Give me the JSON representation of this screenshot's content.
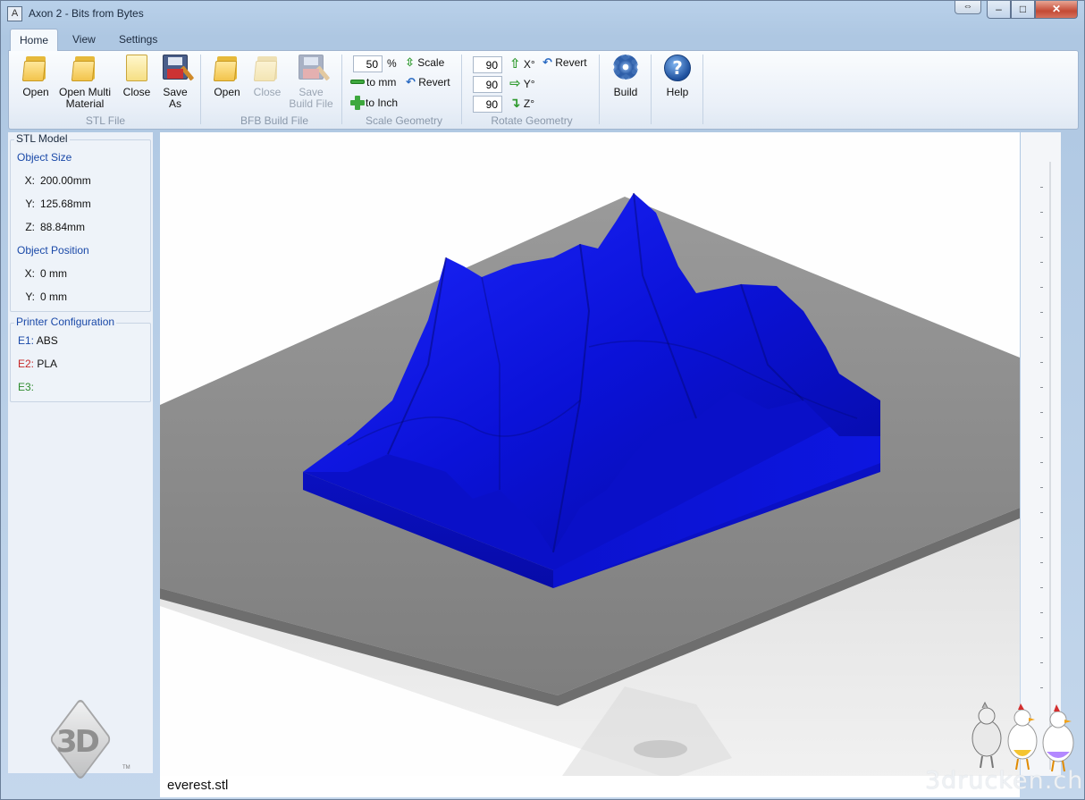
{
  "window": {
    "title": "Axon 2 - Bits from Bytes",
    "controls": {
      "minimize": "–",
      "maximize": "□",
      "close": "✕"
    }
  },
  "ribbon": {
    "tabs": [
      {
        "label": "Home",
        "active": true
      },
      {
        "label": "View",
        "active": false
      },
      {
        "label": "Settings",
        "active": false
      }
    ],
    "stl_file": {
      "group_label": "STL File",
      "open": "Open",
      "open_multi_line1": "Open Multi",
      "open_multi_line2": "Material",
      "close": "Close",
      "save_as_line1": "Save",
      "save_as_line2": "As"
    },
    "bfb_file": {
      "group_label": "BFB Build File",
      "open": "Open",
      "close": "Close",
      "save_line1": "Save",
      "save_line2": "Build File"
    },
    "scale": {
      "group_label": "Scale Geometry",
      "percent_value": "50",
      "percent_sign": "%",
      "scale": "Scale",
      "to_mm": "to mm",
      "revert": "Revert",
      "to_inch": "to Inch"
    },
    "rotate": {
      "group_label": "Rotate Geometry",
      "x_value": "90",
      "y_value": "90",
      "z_value": "90",
      "x_label": "X°",
      "y_label": "Y°",
      "z_label": "Z°",
      "revert": "Revert"
    },
    "build": {
      "label": "Build"
    },
    "help": {
      "label": "Help",
      "glyph": "?"
    }
  },
  "left_panel": {
    "stl_model": {
      "heading": "STL Model",
      "object_size": "Object Size",
      "size_x_label": "X:",
      "size_x": "200.00mm",
      "size_y_label": "Y:",
      "size_y": "125.68mm",
      "size_z_label": "Z:",
      "size_z": "88.84mm",
      "object_position": "Object Position",
      "pos_x_label": "X:",
      "pos_x": "0 mm",
      "pos_y_label": "Y:",
      "pos_y": "0 mm"
    },
    "printer": {
      "heading": "Printer Configuration",
      "e1_label": "E1:",
      "e1_value": "ABS",
      "e2_label": "E2:",
      "e2_value": "PLA",
      "e3_label": "E3:",
      "e3_value": ""
    },
    "logo_text": "3D",
    "logo_tm": "TM"
  },
  "viewport": {
    "model_color": "#0a0fc8",
    "platform_color": "#8e8e8e"
  },
  "status": {
    "file_name": "everest.stl"
  },
  "watermark": "3drucken.ch",
  "colors": {
    "accent_blue": "#1a49a8",
    "e2_red": "#c62828",
    "e3_green": "#2e8b2e"
  }
}
